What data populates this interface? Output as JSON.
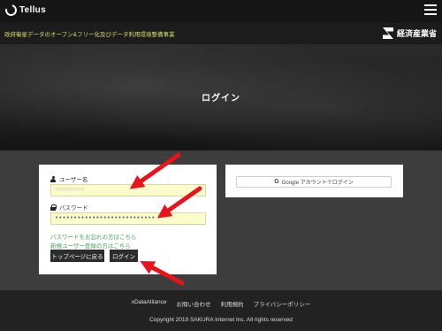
{
  "header": {
    "logo_text": "Tellus",
    "menu_icon": "hamburger-menu-icon"
  },
  "subheader": {
    "tagline": "政府衛星データのオープン&フリー化及びデータ利用環境整備事業",
    "ministry": "経済産業省"
  },
  "hero": {
    "title": "ログイン"
  },
  "login": {
    "username_label": "ユーザー名",
    "username_value": "••••••••",
    "password_label": "パスワード",
    "password_value": "•••••••••••••••••••••••••••",
    "forgot_password_link": "パスワードをお忘れの方はこちら",
    "register_link": "新規ユーザー登録の方はこちら",
    "top_page_button": "トップページに戻る",
    "login_button": "ログイン"
  },
  "google": {
    "icon_letter": "G",
    "button_label": "Google アカウントでログイン"
  },
  "footer": {
    "links": [
      "xDataAlliance",
      "お問い合わせ",
      "利用規約",
      "プライバシーポリシー"
    ],
    "copyright": "Copyright 2019 SAKURA Internet Inc. All rights reserved"
  },
  "colors": {
    "annotation_arrow": "#e8141c",
    "link": "#41a35a",
    "input_background": "#fbfbcc",
    "tagline": "#d7dc6a"
  }
}
